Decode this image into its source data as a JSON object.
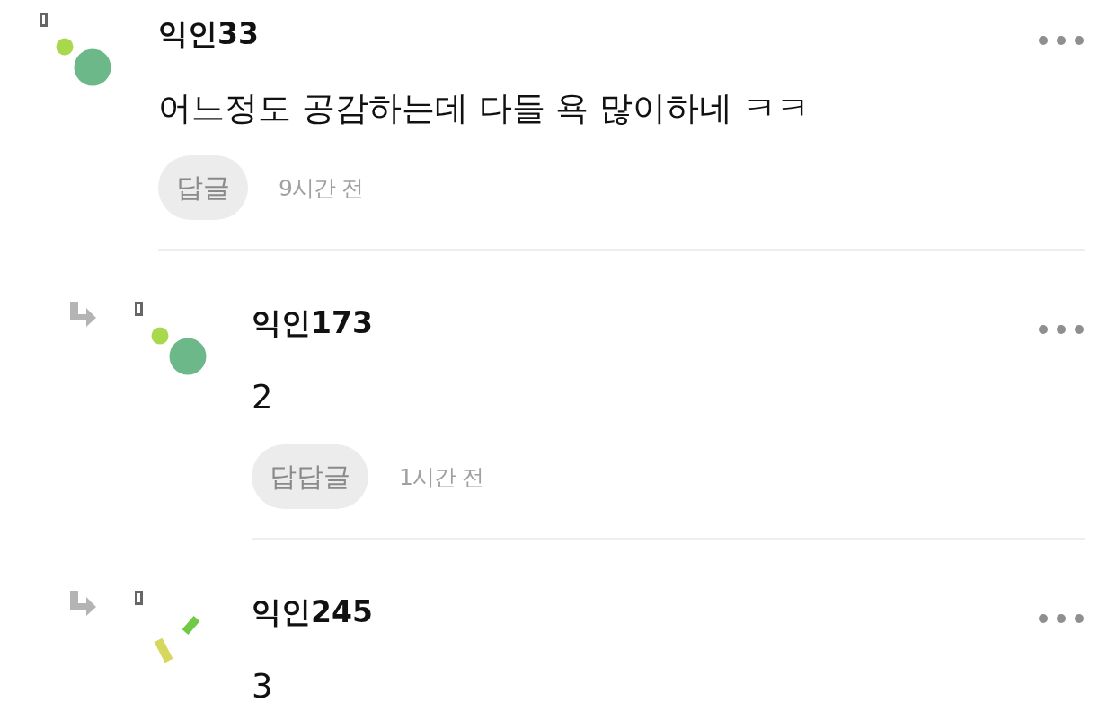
{
  "comments": [
    {
      "kind": "comment",
      "avatar": {
        "kind": "dots"
      },
      "name": "익인33",
      "text": "어느정도 공감하는데 다들 욕 많이하네 ㅋㅋ",
      "reply_label": "답글",
      "time": "9시간 전"
    },
    {
      "kind": "reply",
      "avatar": {
        "kind": "dots"
      },
      "name": "익인173",
      "text": "2",
      "reply_label": "답답글",
      "time": "1시간 전"
    },
    {
      "kind": "reply",
      "avatar": {
        "kind": "bars"
      },
      "name": "익인245",
      "text": "3"
    }
  ]
}
